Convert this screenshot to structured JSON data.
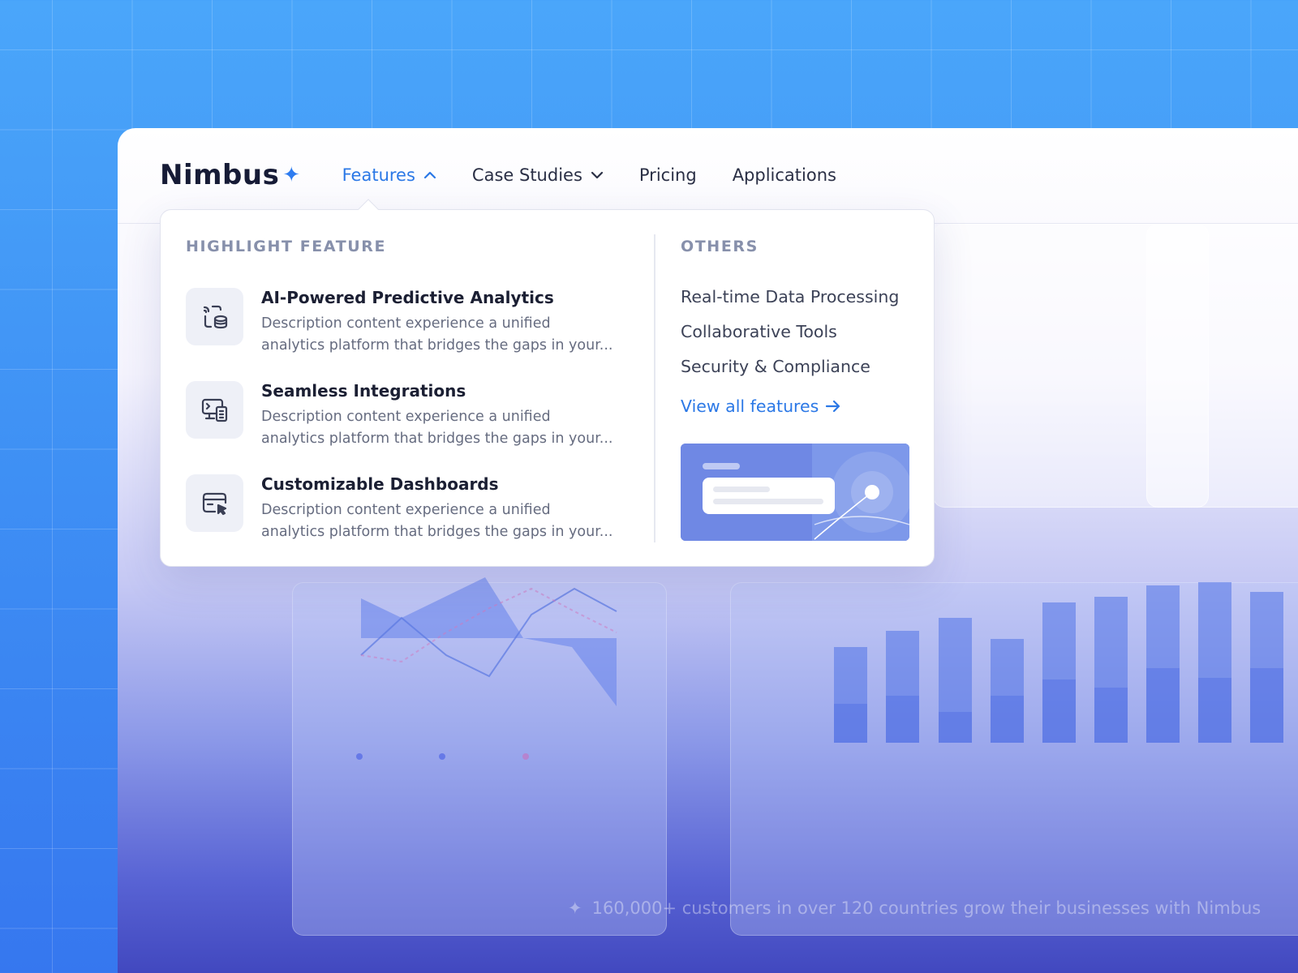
{
  "brand": {
    "name": "Nimbus",
    "star": "✦"
  },
  "nav": {
    "items": [
      {
        "label": "Features",
        "active": true,
        "caret": "up"
      },
      {
        "label": "Case Studies",
        "caret": "down"
      },
      {
        "label": "Pricing"
      },
      {
        "label": "Applications"
      }
    ]
  },
  "dropdown": {
    "highlight_label": "HIGHLIGHT FEATURE",
    "features": [
      {
        "title": "AI-Powered Predictive Analytics",
        "desc_line1": "Description content experience a unified",
        "desc_line2": "analytics platform that bridges the gaps in your...",
        "icon": "ai-analytics-icon"
      },
      {
        "title": "Seamless Integrations",
        "desc_line1": "Description content experience a unified",
        "desc_line2": "analytics platform that bridges the gaps in your...",
        "icon": "integrations-icon"
      },
      {
        "title": "Customizable Dashboards",
        "desc_line1": "Description content experience a unified",
        "desc_line2": "analytics platform that bridges the gaps in your...",
        "icon": "dashboard-icon"
      }
    ],
    "others_label": "OTHERS",
    "others": [
      "Real-time Data Processing",
      "Collaborative Tools",
      "Security & Compliance"
    ],
    "view_all": "View all features"
  },
  "background": {
    "trust_text": "160,000+ customers in over 120 countries grow their businesses with Nimbus"
  },
  "colors": {
    "accent": "#2b78e6",
    "text_dark": "#1b1f33",
    "muted": "#8790ab"
  }
}
